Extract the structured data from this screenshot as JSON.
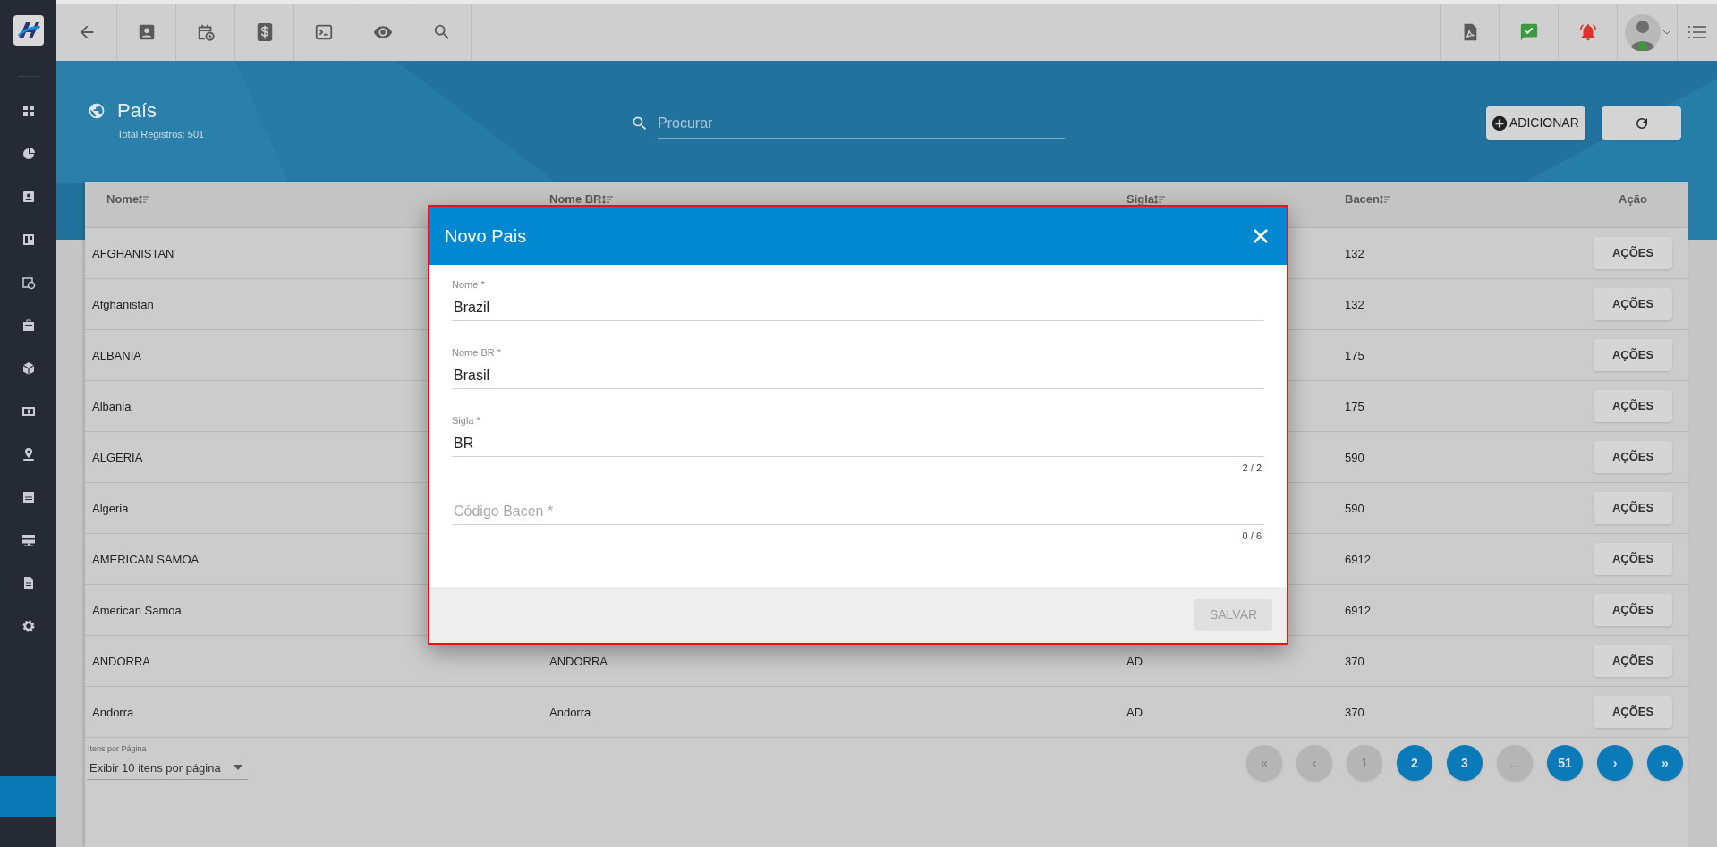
{
  "page": {
    "title": "País",
    "total": "Total Registros: 501",
    "search": {
      "placeholder": "Procurar"
    },
    "add_button": "ADICIONAR"
  },
  "table": {
    "columns": [
      {
        "label": "Nome",
        "sortable": true
      },
      {
        "label": "Nome BR",
        "sortable": true
      },
      {
        "label": "Sigla",
        "sortable": true
      },
      {
        "label": "Bacen",
        "sortable": true
      },
      {
        "label": "Ação",
        "sortable": false
      }
    ],
    "rows": [
      {
        "nome": "AFGHANISTAN",
        "bacen": "132",
        "action": "AÇÕES"
      },
      {
        "nome": "Afghanistan",
        "bacen": "132",
        "action": "AÇÕES"
      },
      {
        "nome": "ALBANIA",
        "bacen": "175",
        "action": "AÇÕES"
      },
      {
        "nome": "Albania",
        "bacen": "175",
        "action": "AÇÕES"
      },
      {
        "nome": "ALGERIA",
        "bacen": "590",
        "action": "AÇÕES"
      },
      {
        "nome": "Algeria",
        "bacen": "590",
        "action": "AÇÕES"
      },
      {
        "nome": "AMERICAN SAMOA",
        "bacen": "6912",
        "action": "AÇÕES"
      },
      {
        "nome": "American Samoa",
        "bacen": "6912",
        "action": "AÇÕES"
      },
      {
        "nome": "ANDORRA",
        "nome_br": "ANDORRA",
        "sigla": "AD",
        "bacen": "370",
        "action": "AÇÕES"
      },
      {
        "nome": "Andorra",
        "nome_br": "Andorra",
        "sigla": "AD",
        "bacen": "370",
        "action": "AÇÕES"
      }
    ]
  },
  "pagination": {
    "per_page_label": "Itens por Página",
    "per_page_value": "Exibir 10 itens por página",
    "pages": [
      {
        "label": "«",
        "disabled": true
      },
      {
        "label": "‹",
        "disabled": true
      },
      {
        "label": "1",
        "disabled": true
      },
      {
        "label": "2",
        "disabled": false
      },
      {
        "label": "3",
        "disabled": false
      },
      {
        "label": "...",
        "disabled": true
      },
      {
        "label": "51",
        "disabled": false
      },
      {
        "label": "›",
        "disabled": false
      },
      {
        "label": "»",
        "disabled": false
      }
    ]
  },
  "dialog": {
    "title": "Novo Pais",
    "fields": [
      {
        "label": "Nome *",
        "value": "Brazil"
      },
      {
        "label": "Nome BR *",
        "value": "Brasil"
      },
      {
        "label": "Sigla *",
        "value": "BR",
        "counter": "2 / 2"
      },
      {
        "placeholder": "Código Bacen *",
        "counter": "0 / 6"
      }
    ],
    "save_button": {
      "label": "SALVAR",
      "disabled": true
    }
  }
}
